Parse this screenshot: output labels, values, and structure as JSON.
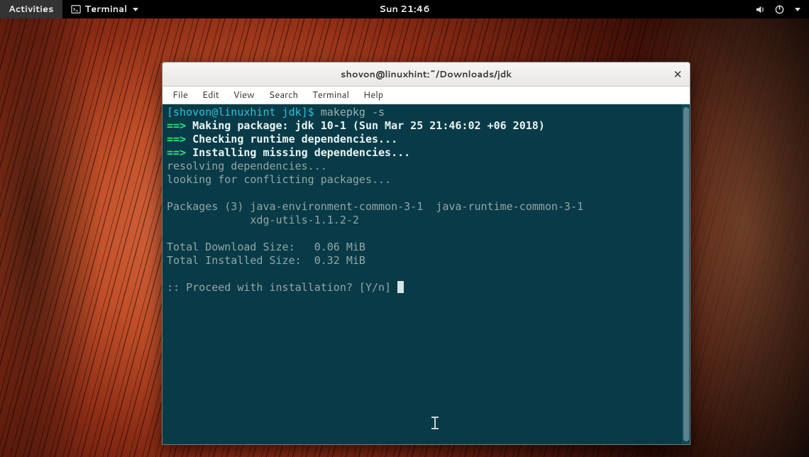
{
  "panel": {
    "activities": "Activities",
    "app_label": "Terminal",
    "clock": "Sun 21:46"
  },
  "window": {
    "title": "shovon@linuxhint:~/Downloads/jdk",
    "menus": [
      "File",
      "Edit",
      "View",
      "Search",
      "Terminal",
      "Help"
    ]
  },
  "prompt": {
    "text": "[shovon@linuxhint jdk]$",
    "command": "makepkg -s"
  },
  "lines": {
    "l1": "Making package: jdk 10-1 (Sun Mar 25 21:46:02 +06 2018)",
    "l2": "Checking runtime dependencies...",
    "l3": "Installing missing dependencies...",
    "l4": "resolving dependencies...",
    "l5": "looking for conflicting packages...",
    "l6": "Packages (3) java-environment-common-3-1  java-runtime-common-3-1",
    "l7": "             xdg-utils-1.1.2-2",
    "l8": "Total Download Size:   0.06 MiB",
    "l9": "Total Installed Size:  0.32 MiB",
    "l10": ":: Proceed with installation? [Y/n] "
  },
  "arrow": "==>"
}
